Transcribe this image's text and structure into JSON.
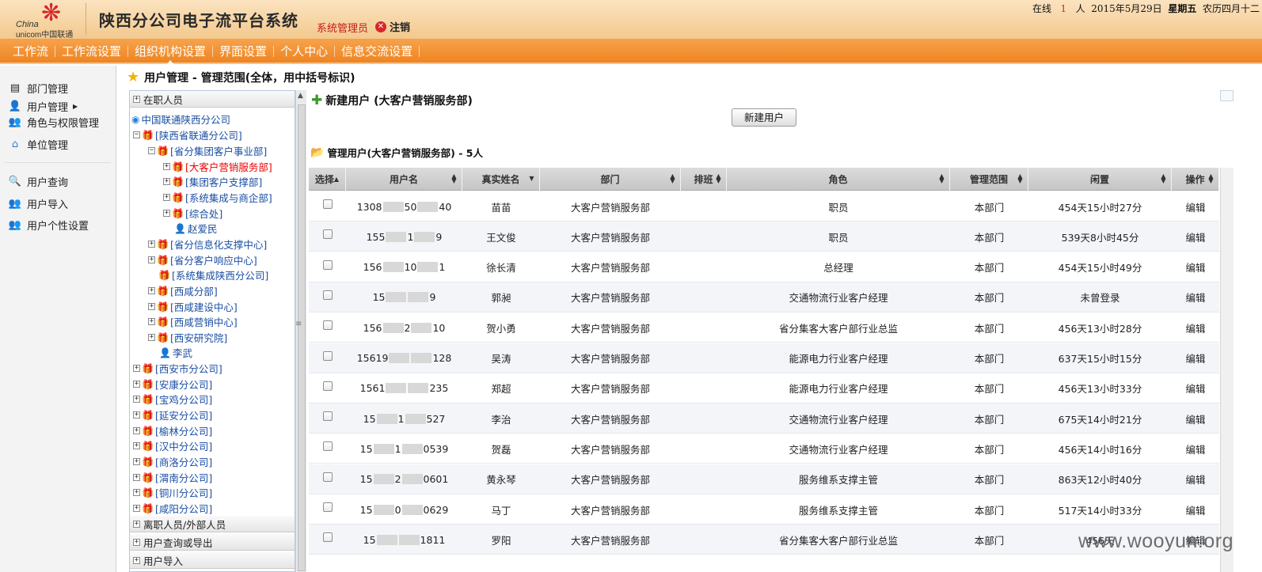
{
  "header": {
    "logo_china": "China",
    "logo_unicom": "unicom中国联通",
    "title": "陕西分公司电子流平台系统",
    "user_role": "系统管理员",
    "logout_label": "注销",
    "status": {
      "online_prefix": "在线",
      "online_count": "1",
      "online_suffix": "人",
      "date": "2015年5月29日",
      "weekday": "星期五",
      "lunar": "农历四月十二"
    }
  },
  "nav": [
    "工作流",
    "工作流设置",
    "组织机构设置",
    "界面设置",
    "个人中心",
    "信息交流设置"
  ],
  "sidebar": [
    {
      "label": "部门管理",
      "icon": "department-icon"
    },
    {
      "label": "用户管理",
      "icon": "user-icon"
    },
    {
      "label": "角色与权限管理",
      "icon": "role-icon"
    },
    {
      "label": "单位管理",
      "icon": "home-icon"
    },
    {
      "label": "用户查询",
      "icon": "search-icon"
    },
    {
      "label": "用户导入",
      "icon": "import-icon"
    },
    {
      "label": "用户个性设置",
      "icon": "settings-icon"
    }
  ],
  "page_title": "用户管理 - 管理范围(全体，用中括号标识)",
  "tree": {
    "section_active": "在职人员",
    "nodes": [
      "中国联通陕西分公司",
      "[陕西省联通分公司]",
      "[省分集团客户事业部]",
      "[大客户营销服务部]",
      "[集团客户支撑部]",
      "[系统集成与商企部]",
      "[综合处]",
      "赵爱民",
      "[省分信息化支撑中心]",
      "[省分客户响应中心]",
      "[系统集成陕西分公司]",
      "[西咸分部]",
      "[西咸建设中心]",
      "[西咸营销中心]",
      "[西安研究院]",
      "李武",
      "[西安市分公司]",
      "[安康分公司]",
      "[宝鸡分公司]",
      "[延安分公司]",
      "[榆林分公司]",
      "[汉中分公司]",
      "[商洛分公司]",
      "[渭南分公司]",
      "[铜川分公司]",
      "[咸阳分公司]"
    ],
    "sections_below": [
      "离职人员/外部人员",
      "用户查询或导出",
      "用户导入"
    ]
  },
  "new_user": {
    "title": "新建用户  (大客户营销服务部)",
    "button_label": "新建用户"
  },
  "managed_title": "管理用户(大客户营销服务部) - 5人",
  "table": {
    "columns": [
      "选择",
      "用户名",
      "真实姓名",
      "部门",
      "排班",
      "角色",
      "管理范围",
      "闲置",
      "操作"
    ],
    "rows": [
      {
        "user_a": "1308",
        "user_b": "50",
        "user_c": "40",
        "name": "苗苗",
        "dept": "大客户营销服务部",
        "role": "职员",
        "scope": "本部门",
        "idle": "454天15小时27分",
        "op": "编辑"
      },
      {
        "user_a": "155",
        "user_b": "1",
        "user_c": "9",
        "name": "王文俊",
        "dept": "大客户营销服务部",
        "role": "职员",
        "scope": "本部门",
        "idle": "539天8小时45分",
        "op": "编辑"
      },
      {
        "user_a": "156",
        "user_b": "10",
        "user_c": "1",
        "name": "徐长清",
        "dept": "大客户营销服务部",
        "role": "总经理",
        "scope": "本部门",
        "idle": "454天15小时49分",
        "op": "编辑"
      },
      {
        "user_a": "15",
        "user_b": "",
        "user_c": "9",
        "name": "郭昶",
        "dept": "大客户营销服务部",
        "role": "交通物流行业客户经理",
        "scope": "本部门",
        "idle": "未曾登录",
        "op": "编辑"
      },
      {
        "user_a": "156",
        "user_b": "2",
        "user_c": "10",
        "name": "贺小勇",
        "dept": "大客户营销服务部",
        "role": "省分集客大客户部行业总监",
        "scope": "本部门",
        "idle": "456天13小时28分",
        "op": "编辑"
      },
      {
        "user_a": "15619",
        "user_b": "",
        "user_c": "128",
        "name": "吴涛",
        "dept": "大客户营销服务部",
        "role": "能源电力行业客户经理",
        "scope": "本部门",
        "idle": "637天15小时15分",
        "op": "编辑"
      },
      {
        "user_a": "1561",
        "user_b": "",
        "user_c": "235",
        "name": "郑超",
        "dept": "大客户营销服务部",
        "role": "能源电力行业客户经理",
        "scope": "本部门",
        "idle": "456天13小时33分",
        "op": "编辑"
      },
      {
        "user_a": "15",
        "user_b": "1",
        "user_c": "527",
        "name": "李治",
        "dept": "大客户营销服务部",
        "role": "交通物流行业客户经理",
        "scope": "本部门",
        "idle": "675天14小时21分",
        "op": "编辑"
      },
      {
        "user_a": "15",
        "user_b": "1",
        "user_c": "0539",
        "name": "贺磊",
        "dept": "大客户营销服务部",
        "role": "交通物流行业客户经理",
        "scope": "本部门",
        "idle": "456天14小时16分",
        "op": "编辑"
      },
      {
        "user_a": "15",
        "user_b": "2",
        "user_c": "0601",
        "name": "黄永琴",
        "dept": "大客户营销服务部",
        "role": "服务维系支撑主管",
        "scope": "本部门",
        "idle": "863天12小时40分",
        "op": "编辑"
      },
      {
        "user_a": "15",
        "user_b": "0",
        "user_c": "0629",
        "name": "马丁",
        "dept": "大客户营销服务部",
        "role": "服务维系支撑主管",
        "scope": "本部门",
        "idle": "517天14小时33分",
        "op": "编辑"
      },
      {
        "user_a": "15",
        "user_b": "",
        "user_c": "1811",
        "name": "罗阳",
        "dept": "大客户营销服务部",
        "role": "省分集客大客户部行业总监",
        "scope": "本部门",
        "idle": "456天",
        "op": "编辑"
      }
    ]
  },
  "watermark": "www.wooyun.org",
  "colors": {
    "brand_orange": "#ee8422",
    "brand_red": "#d6262b",
    "link_blue": "#1a4ea3"
  }
}
